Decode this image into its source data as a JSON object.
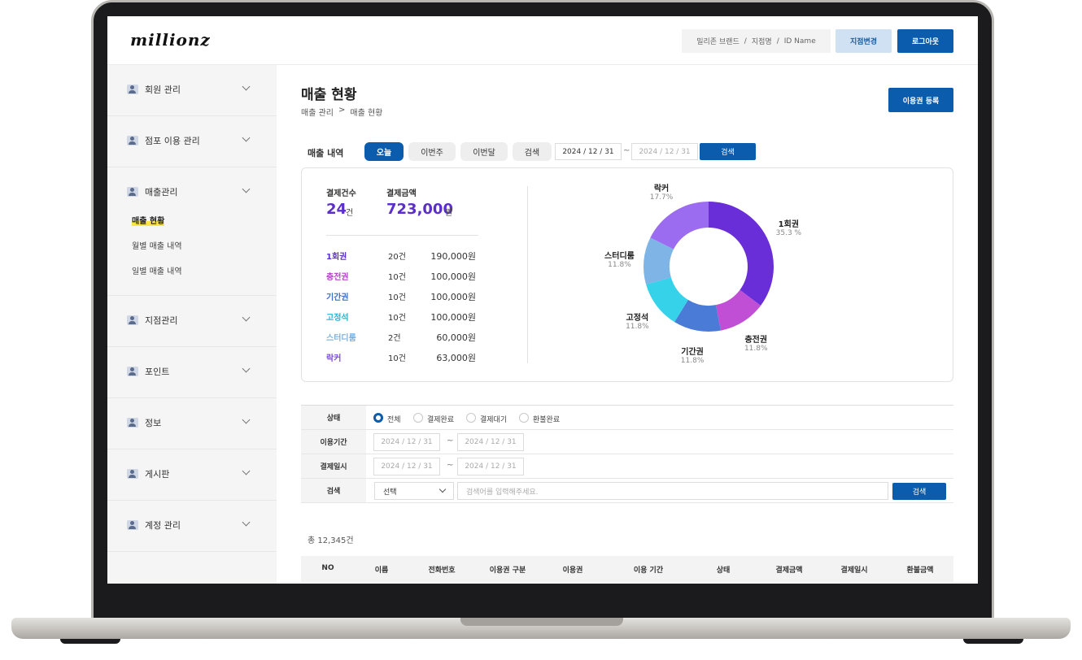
{
  "header": {
    "logo": "millionz",
    "breadcrumb_info": [
      "밀리존 브랜드",
      "/",
      "지점명",
      "/",
      "ID Name"
    ],
    "branch_button": "지점변경",
    "logout_button": "로그아웃"
  },
  "sidebar": {
    "menus": [
      {
        "label": "회원 관리"
      },
      {
        "label": "점포 이용 관리"
      },
      {
        "label": "매출관리"
      },
      {
        "label": "지점관리"
      },
      {
        "label": "포인트"
      },
      {
        "label": "정보"
      },
      {
        "label": "게시판"
      },
      {
        "label": "계정 관리"
      }
    ],
    "sub_items": [
      "매출 현황",
      "월별 매출 내역",
      "일별 매출 내역"
    ]
  },
  "page": {
    "title": "매출 현황",
    "breadcrumb": [
      "매출 관리",
      ">",
      "매출 현황"
    ],
    "register_button": "이용권 등록"
  },
  "sales_filter": {
    "label": "매출 내역",
    "tabs": [
      "오늘",
      "이번주",
      "이번달",
      "검색"
    ],
    "active_tab": "오늘",
    "date_from": "2024 / 12 / 31",
    "date_to_placeholder": "2024 / 12 / 31",
    "tilde": "~",
    "search_button": "검색"
  },
  "summary": {
    "count_label": "결제건수",
    "count_value": "24",
    "count_unit": "건",
    "amount_label": "결제금액",
    "amount_value": "723,000",
    "amount_unit": "원",
    "rows": [
      {
        "name": "1회권",
        "count": "20건",
        "amount": "190,000원",
        "color": "#5b2fc9"
      },
      {
        "name": "충전권",
        "count": "10건",
        "amount": "100,000원",
        "color": "#b43fc9"
      },
      {
        "name": "기간권",
        "count": "10건",
        "amount": "100,000원",
        "color": "#3c6fc4"
      },
      {
        "name": "고정석",
        "count": "10건",
        "amount": "100,000원",
        "color": "#23b7d1"
      },
      {
        "name": "스터디룸",
        "count": "2건",
        "amount": "60,000원",
        "color": "#7fb1dc"
      },
      {
        "name": "락커",
        "count": "10건",
        "amount": "63,000원",
        "color": "#7d4fd8"
      }
    ]
  },
  "chart_data": {
    "type": "pie",
    "donut": true,
    "slices": [
      {
        "label": "1회권",
        "pct_text": "35.3 %",
        "value": 35.3,
        "color": "#6a2ed9"
      },
      {
        "label": "충전권",
        "pct_text": "11.8%",
        "value": 11.8,
        "color": "#c04fd6"
      },
      {
        "label": "기간권",
        "pct_text": "11.8%",
        "value": 11.8,
        "color": "#4a7bd6"
      },
      {
        "label": "고정석",
        "pct_text": "11.8%",
        "value": 11.8,
        "color": "#35d2ea"
      },
      {
        "label": "스터디룸",
        "pct_text": "11.8%",
        "value": 11.8,
        "color": "#7eb5e6"
      },
      {
        "label": "락커",
        "pct_text": "17.7%",
        "value": 17.7,
        "color": "#9b6cf0"
      }
    ]
  },
  "filter": {
    "status_label": "상태",
    "status_options": [
      "전체",
      "결제완료",
      "결제대기",
      "환불완료"
    ],
    "status_selected": "전체",
    "period_label": "이용기간",
    "paydate_label": "결제일시",
    "date_placeholder": "2024 / 12 / 31",
    "tilde": "~",
    "search_label": "검색",
    "select_value": "선택",
    "search_placeholder": "검색어를 입력해주세요.",
    "search_button": "검색"
  },
  "table": {
    "total": "총 12,345건",
    "columns": [
      "NO",
      "이름",
      "전화번호",
      "이용권 구분",
      "이용권",
      "이용 기간",
      "상태",
      "결제금액",
      "결제일시",
      "환불금액"
    ]
  }
}
